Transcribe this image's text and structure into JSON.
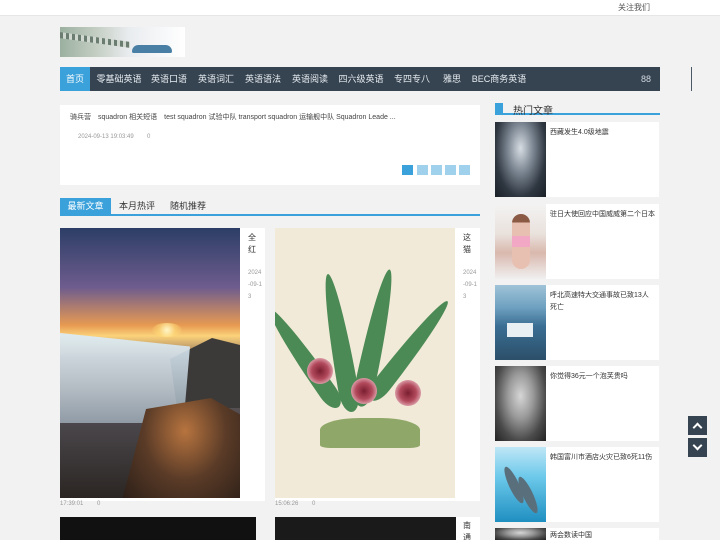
{
  "topbar": {
    "follow": "关注我们"
  },
  "nav": {
    "items": [
      "首页",
      "零基础英语",
      "英语口语",
      "英语词汇",
      "英语语法",
      "英语阅读",
      "四六级英语",
      "专四专八",
      "雅思",
      "BEC商务英语"
    ],
    "grid_icon": "88"
  },
  "slider": {
    "title": "骑兵营　squadron 相关短语　test squadron 试验中队 transport squadron 运输舰中队 Squadron Leade ...",
    "date": "2024-09-13 19:03:49",
    "count": "0"
  },
  "tabs": [
    "最新文章",
    "本月热评",
    "随机推荐"
  ],
  "cards": [
    {
      "title": "全红",
      "date": "2024-09-13",
      "meta_time": "17:39:01",
      "meta_count": "0"
    },
    {
      "title": "这猫",
      "date": "2024-09-13",
      "meta_time": "15:06:26",
      "meta_count": "0"
    },
    {
      "title": "南通"
    }
  ],
  "hot": {
    "title": "热门文章",
    "items": [
      "西藏发生4.0级地震",
      "驻日大使回应中国威威第二个日本",
      "呼北高速特大交通事故已致13人死亡",
      "你觉得36元一个泡芙贵吗",
      "韩国富川市酒店火灾已致6死11伤",
      "两会数读中国"
    ]
  },
  "accent": "#3aa1db",
  "nav_bg": "#364350"
}
